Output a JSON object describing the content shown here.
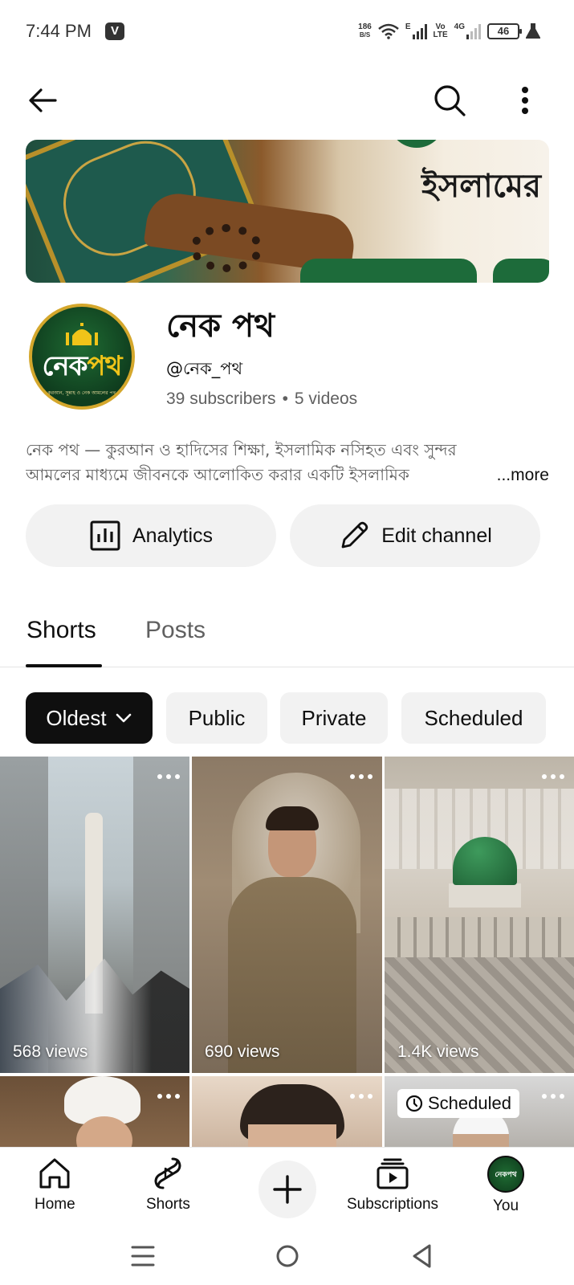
{
  "status_bar": {
    "time": "7:44 PM",
    "notification_icon": "V",
    "net_speed_value": "186",
    "net_speed_unit": "B/S",
    "network_type": "E",
    "volte_line1": "Vo",
    "volte_line2": "LTE",
    "network_4g": "4G",
    "battery": "46"
  },
  "top_bar": {
    "back_icon": "arrow-left",
    "search_icon": "magnifier",
    "more_icon": "three-dots-vertical"
  },
  "banner": {
    "text": "ইসলামের"
  },
  "channel": {
    "avatar_text_part1": "নেক",
    "avatar_text_part2": "পথ",
    "avatar_subtitle": "কুরআন, সুন্নাহ ও নেক আমলের পথ",
    "name": "নেক পথ",
    "handle": "@নেক_পথ",
    "subscribers": "39 subscribers",
    "separator": "•",
    "videos": "5 videos",
    "description_line1": "নেক পথ — কুরআন ও হাদিসের শিক্ষা, ইসলামিক নসিহত এবং সুন্দর",
    "description_line2": "আমলের মাধ্যমে জীবনকে আলোকিত করার একটি ইসলামিক",
    "more_label": "...more"
  },
  "actions": {
    "analytics_label": "Analytics",
    "edit_label": "Edit channel"
  },
  "tabs": {
    "shorts": "Shorts",
    "posts": "Posts"
  },
  "filters": {
    "sort": "Oldest",
    "public": "Public",
    "private": "Private",
    "scheduled": "Scheduled"
  },
  "shorts": [
    {
      "views": "568 views"
    },
    {
      "views": "690 views"
    },
    {
      "views": "1.4K views"
    },
    {
      "views": ""
    },
    {
      "views": ""
    },
    {
      "badge": "Scheduled"
    }
  ],
  "bottom_nav": {
    "home": "Home",
    "shorts": "Shorts",
    "subscriptions": "Subscriptions",
    "you": "You",
    "you_avatar_text": "নেকপথ"
  },
  "colors": {
    "text_primary": "#0f0f0f",
    "text_secondary": "#606060",
    "chip_bg": "#f2f2f2",
    "chip_selected_bg": "#0f0f0f",
    "avatar_ring": "#d4a72c",
    "avatar_green": "#1f6b33"
  }
}
